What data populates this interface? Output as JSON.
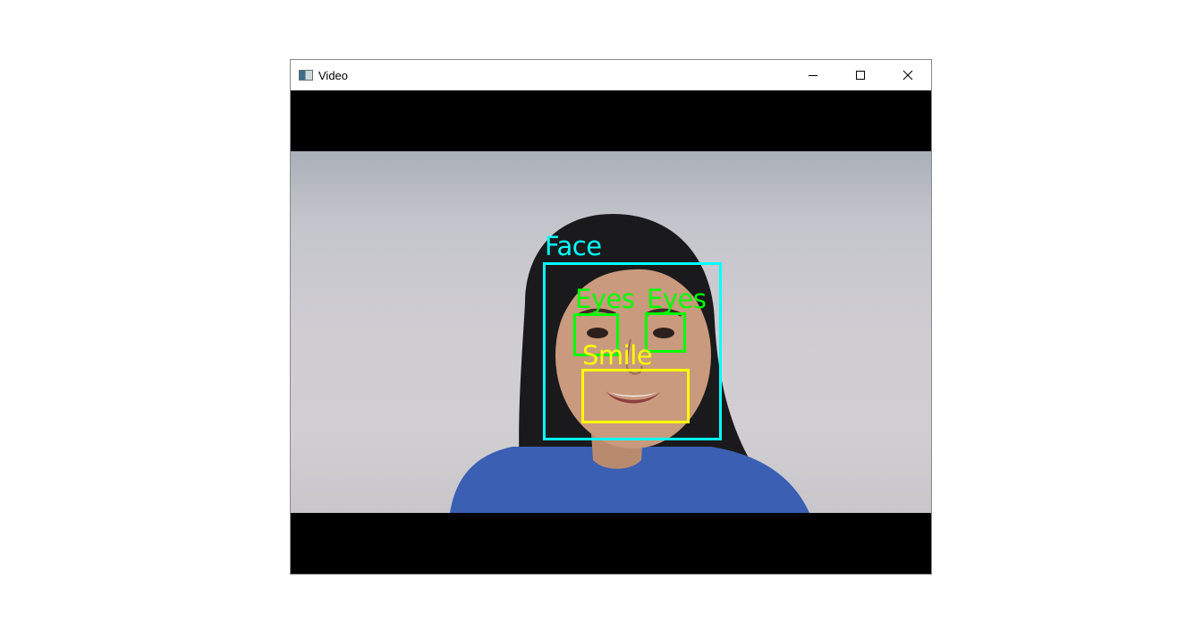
{
  "window": {
    "title": "Video",
    "icon": "app-window-icon",
    "controls": [
      "minimize-icon",
      "maximize-icon",
      "close-icon"
    ]
  },
  "detections": {
    "face": {
      "label": "Face",
      "color": "#00ffff"
    },
    "eye_left": {
      "label": "Eyes",
      "color": "#00ff00"
    },
    "eye_right": {
      "label": "Eyes",
      "color": "#00ff00"
    },
    "smile": {
      "label": "Smile",
      "color": "#ffff00"
    }
  }
}
